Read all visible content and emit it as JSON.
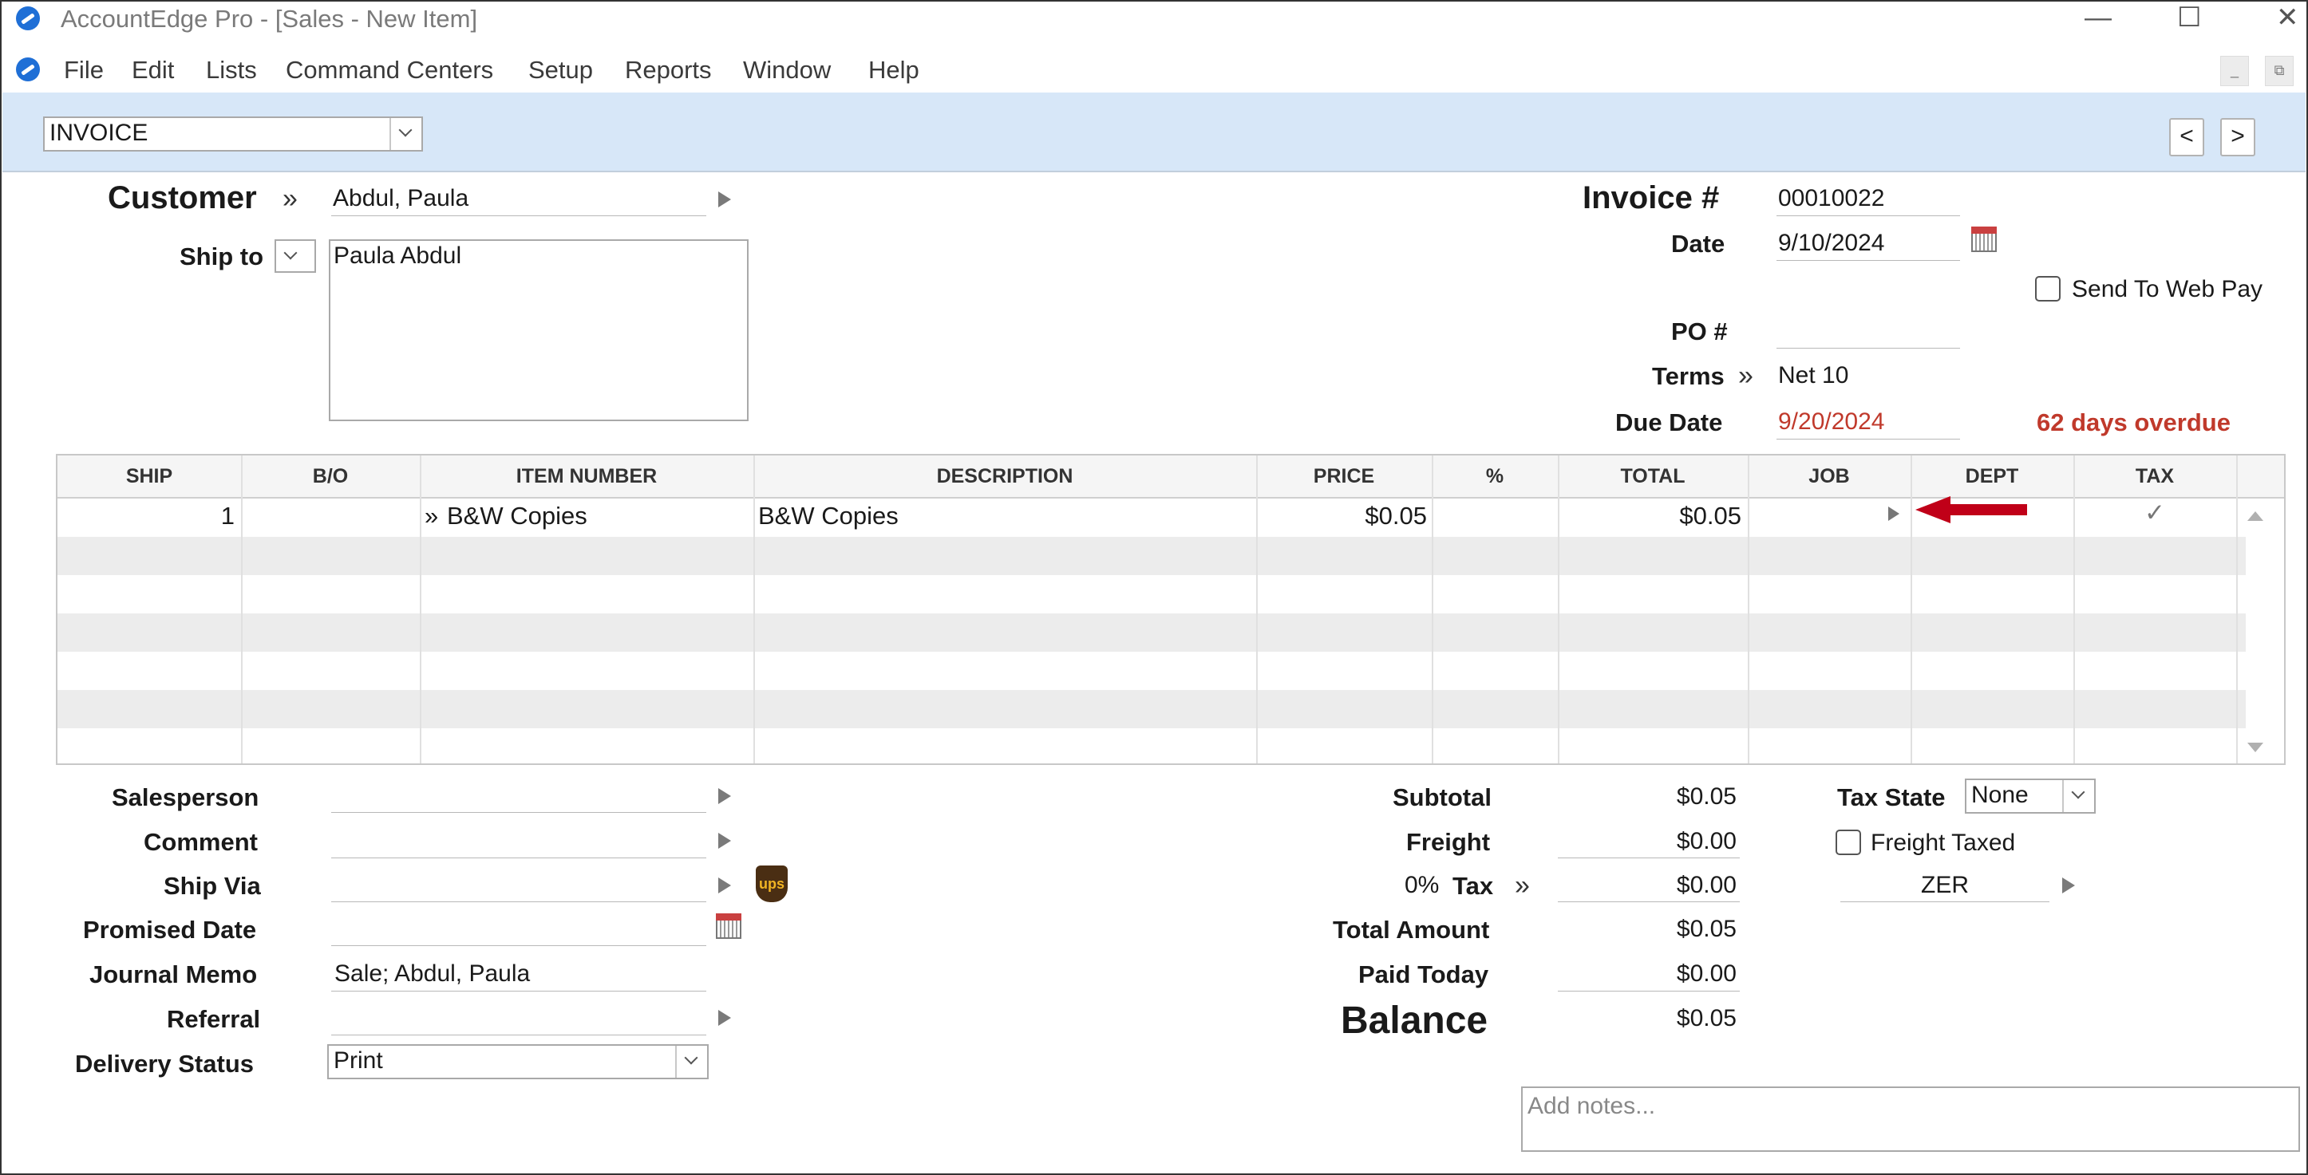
{
  "window": {
    "title": "AccountEdge Pro - [Sales - New Item]",
    "minimize_glyph": "—",
    "maximize_glyph": "☐",
    "close_glyph": "✕",
    "mdi_min_glyph": "_",
    "mdi_restore_glyph": "⧉"
  },
  "menu": [
    "File",
    "Edit",
    "Lists",
    "Command Centers",
    "Setup",
    "Reports",
    "Window",
    "Help"
  ],
  "toolbar": {
    "layout_select": "INVOICE",
    "prev": "<",
    "next": ">"
  },
  "header": {
    "customer_label": "Customer",
    "customer_value": "Abdul, Paula",
    "ship_to_label": "Ship to",
    "ship_to_value": "Paula Abdul",
    "invoice_label": "Invoice #",
    "invoice_value": "00010022",
    "date_label": "Date",
    "date_value": "9/10/2024",
    "send_web_pay_label": "Send To Web Pay",
    "po_label": "PO #",
    "po_value": "",
    "terms_label": "Terms",
    "terms_value": "Net 10",
    "due_date_label": "Due Date",
    "due_date_value": "9/20/2024",
    "overdue_text": "62 days overdue"
  },
  "table": {
    "columns": [
      "SHIP",
      "B/O",
      "ITEM NUMBER",
      "DESCRIPTION",
      "PRICE",
      "%",
      "TOTAL",
      "JOB",
      "DEPT",
      "TAX"
    ],
    "rows": [
      {
        "ship": "1",
        "bo": "",
        "item": "B&W Copies",
        "description": "B&W Copies",
        "price": "$0.05",
        "pct": "",
        "total": "$0.05",
        "job": "",
        "dept": "",
        "tax": "✓"
      }
    ]
  },
  "footer_left": {
    "salesperson_label": "Salesperson",
    "salesperson_value": "",
    "comment_label": "Comment",
    "comment_value": "",
    "ship_via_label": "Ship Via",
    "ship_via_value": "",
    "ups_logo_text": "ups",
    "promised_date_label": "Promised Date",
    "promised_date_value": "",
    "journal_memo_label": "Journal Memo",
    "journal_memo_value": "Sale; Abdul, Paula",
    "referral_label": "Referral",
    "referral_value": "",
    "delivery_status_label": "Delivery Status",
    "delivery_status_value": "Print"
  },
  "totals": {
    "subtotal_label": "Subtotal",
    "subtotal_value": "$0.05",
    "freight_label": "Freight",
    "freight_value": "$0.00",
    "tax_pct": "0%",
    "tax_label": "Tax",
    "tax_value": "$0.00",
    "total_amount_label": "Total Amount",
    "total_amount_value": "$0.05",
    "paid_today_label": "Paid Today",
    "paid_today_value": "$0.00",
    "balance_label": "Balance",
    "balance_value": "$0.05"
  },
  "tax_panel": {
    "tax_state_label": "Tax State",
    "tax_state_value": "None",
    "freight_taxed_label": "Freight Taxed",
    "tax_code_value": "ZER"
  },
  "notes": {
    "placeholder": "Add notes..."
  },
  "colors": {
    "band": "#d7e7f8",
    "overdue": "#c0392b",
    "due_date": "#c0392b",
    "arrow": "#c00018"
  }
}
